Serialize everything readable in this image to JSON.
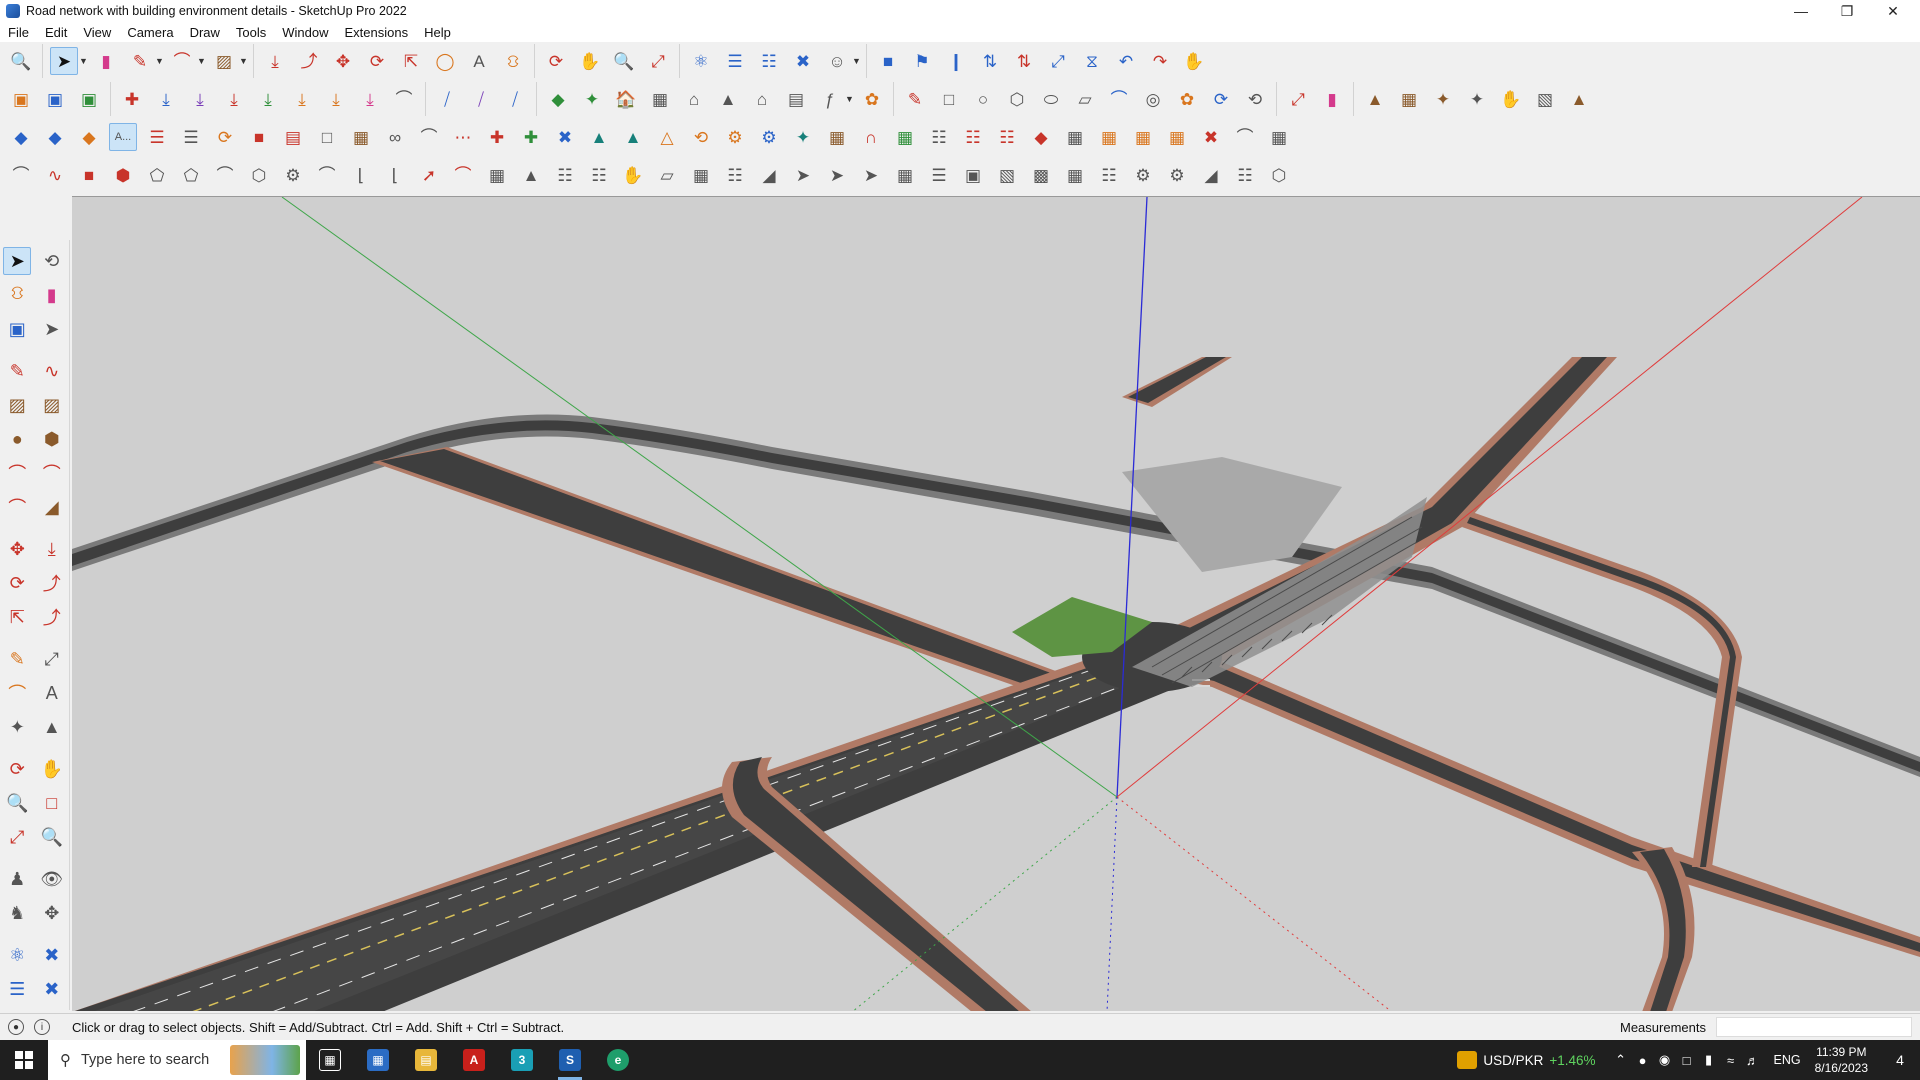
{
  "window": {
    "title": "Road network with building environment details - SketchUp Pro 2022",
    "controls": [
      "minimize",
      "restore",
      "close"
    ]
  },
  "menu": [
    "File",
    "Edit",
    "View",
    "Camera",
    "Draw",
    "Tools",
    "Window",
    "Extensions",
    "Help"
  ],
  "toolbars": {
    "tooltip_tag": "A..."
  },
  "status": {
    "hint": "Click or drag to select objects. Shift = Add/Subtract. Ctrl = Add. Shift + Ctrl = Subtract.",
    "measurements_label": "Measurements",
    "measurements_value": ""
  },
  "taskbar": {
    "search_placeholder": "Type here to search",
    "stock_pair": "USD/PKR",
    "stock_change": "+1.46%",
    "language": "ENG",
    "time": "11:39 PM",
    "date": "8/16/2023",
    "notification_count": "4"
  },
  "colors": {
    "road_asphalt": "#3e3e3e",
    "road_curb": "#b07a66",
    "ground": "#cfcfcf",
    "park": "#5e9444",
    "axis_red": "#e03c3c",
    "axis_green": "#3fa64a",
    "axis_blue": "#2b2bd6"
  }
}
